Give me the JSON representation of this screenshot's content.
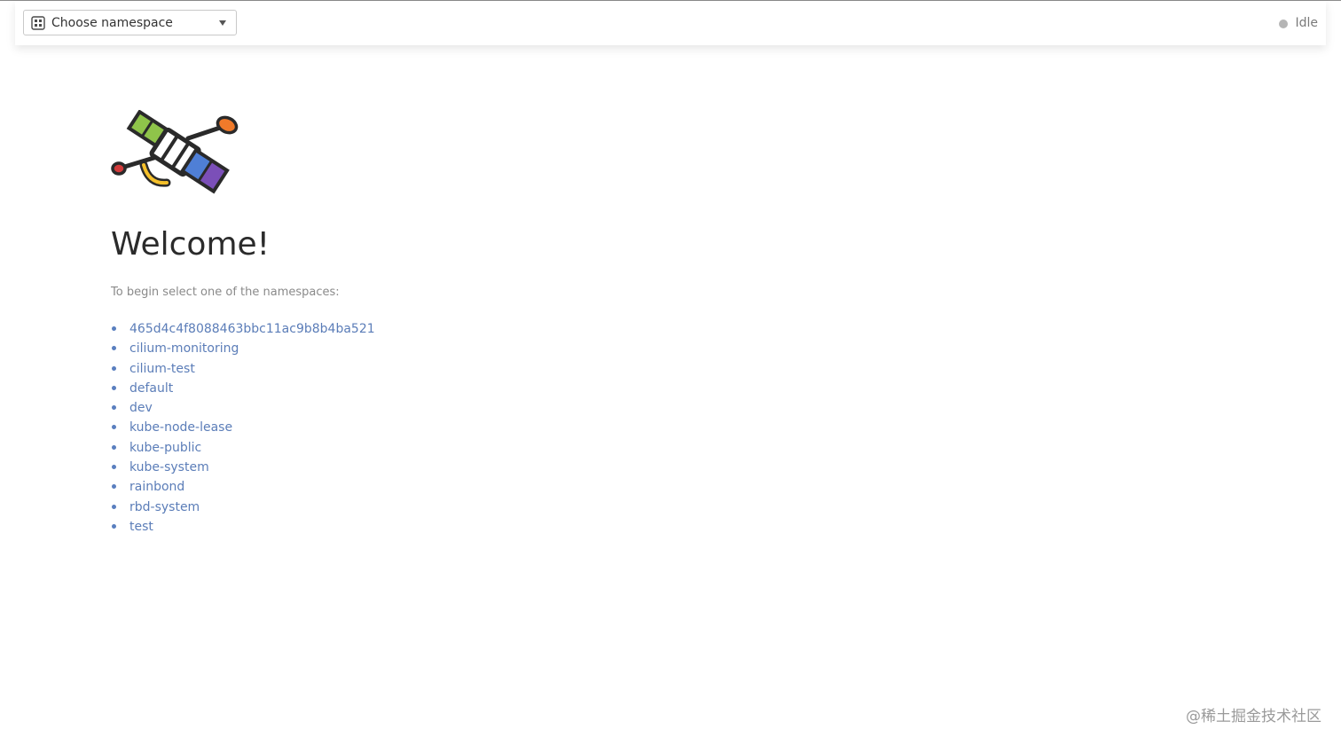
{
  "header": {
    "namespace_select": {
      "icon": "namespace-icon",
      "placeholder": "Choose namespace"
    },
    "status": {
      "label": "Idle",
      "dot_color": "#b5b5b5"
    }
  },
  "main": {
    "logo": "satellite-logo",
    "title": "Welcome!",
    "subtitle": "To begin select one of the namespaces:",
    "namespaces": [
      "465d4c4f8088463bbc11ac9b8b4ba521",
      "cilium-monitoring",
      "cilium-test",
      "default",
      "dev",
      "kube-node-lease",
      "kube-public",
      "kube-system",
      "rainbond",
      "rbd-system",
      "test"
    ],
    "link_color": "#5b7db8"
  },
  "watermark": "@稀土掘金技术社区"
}
